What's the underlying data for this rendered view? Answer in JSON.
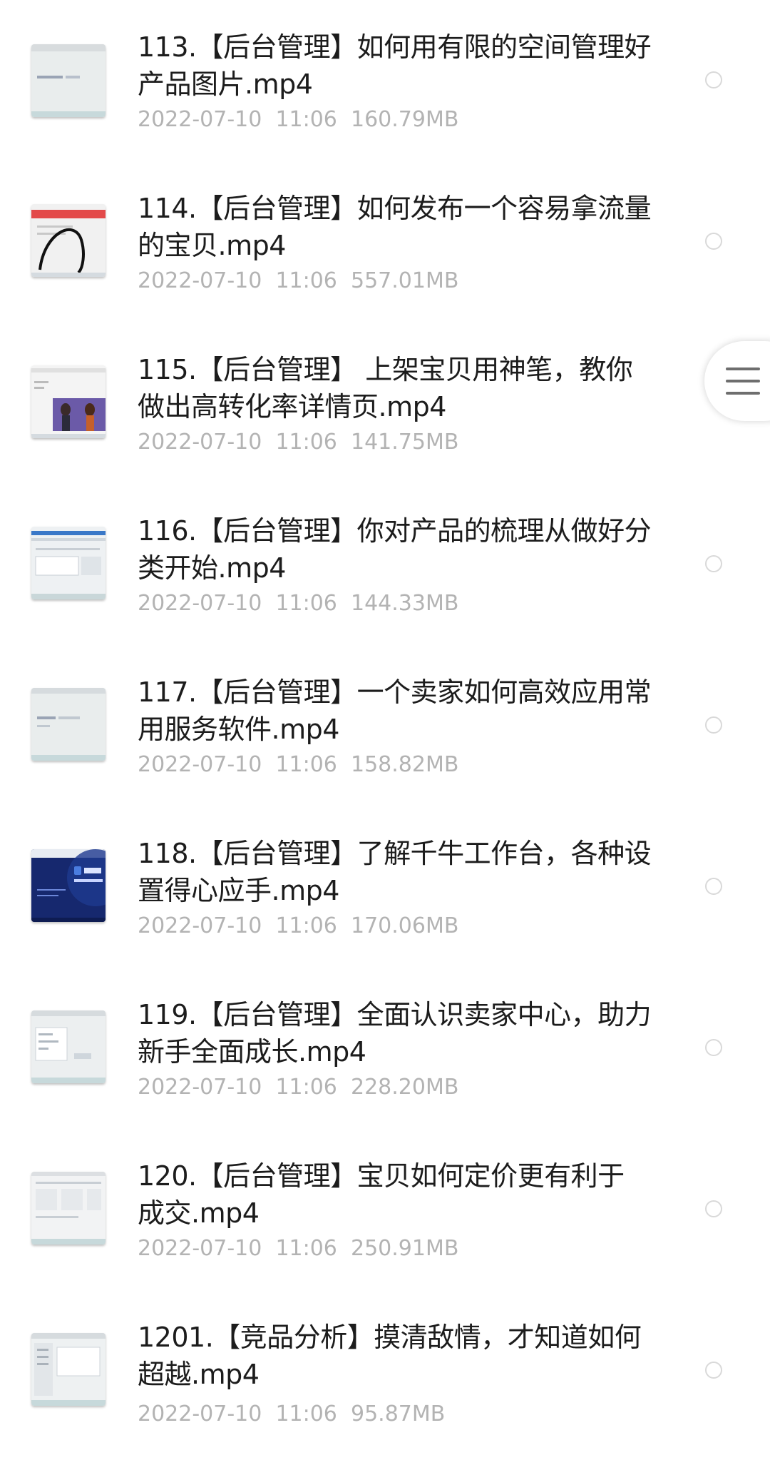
{
  "files": [
    {
      "title_line1": "113.【后台管理】如何用有限的空间管理好",
      "title_line2": "产品图片.mp4",
      "date": "2022-07-10",
      "time": "11:06",
      "size": "160.79MB",
      "thumb_icon": "video-thumbnail-icon"
    },
    {
      "title_line1": "114.【后台管理】如何发布一个容易拿流量",
      "title_line2": "的宝贝.mp4",
      "date": "2022-07-10",
      "time": "11:06",
      "size": "557.01MB",
      "thumb_icon": "video-thumbnail-icon"
    },
    {
      "title_line1": "115.【后台管理】 上架宝贝用神笔，教你",
      "title_line2": "做出高转化率详情页.mp4",
      "date": "2022-07-10",
      "time": "11:06",
      "size": "141.75MB",
      "thumb_icon": "video-thumbnail-icon"
    },
    {
      "title_line1": "116.【后台管理】你对产品的梳理从做好分",
      "title_line2": "类开始.mp4",
      "date": "2022-07-10",
      "time": "11:06",
      "size": "144.33MB",
      "thumb_icon": "video-thumbnail-icon"
    },
    {
      "title_line1": "117.【后台管理】一个卖家如何高效应用常",
      "title_line2": "用服务软件.mp4",
      "date": "2022-07-10",
      "time": "11:06",
      "size": "158.82MB",
      "thumb_icon": "video-thumbnail-icon"
    },
    {
      "title_line1": "118.【后台管理】了解千牛工作台，各种设",
      "title_line2": "置得心应手.mp4",
      "date": "2022-07-10",
      "time": "11:06",
      "size": "170.06MB",
      "thumb_icon": "video-thumbnail-icon"
    },
    {
      "title_line1": "119.【后台管理】全面认识卖家中心，助力",
      "title_line2": "新手全面成长.mp4",
      "date": "2022-07-10",
      "time": "11:06",
      "size": "228.20MB",
      "thumb_icon": "video-thumbnail-icon"
    },
    {
      "title_line1": "120.【后台管理】宝贝如何定价更有利于",
      "title_line2": "成交.mp4",
      "date": "2022-07-10",
      "time": "11:06",
      "size": "250.91MB",
      "thumb_icon": "video-thumbnail-icon"
    },
    {
      "title_line1": "1201.【竞品分析】摸清敌情，才知道如何",
      "title_line2": "超越.mp4",
      "date": "2022-07-10",
      "time": "11:06",
      "size": "95.87MB",
      "thumb_icon": "video-thumbnail-icon"
    }
  ],
  "colors": {
    "title": "#1c1c1c",
    "meta": "#b3b3b3",
    "radio_border": "#d9d9d9",
    "menu_icon": "#6e6e6e"
  },
  "floating_menu": {
    "icon": "hamburger-menu-icon"
  }
}
